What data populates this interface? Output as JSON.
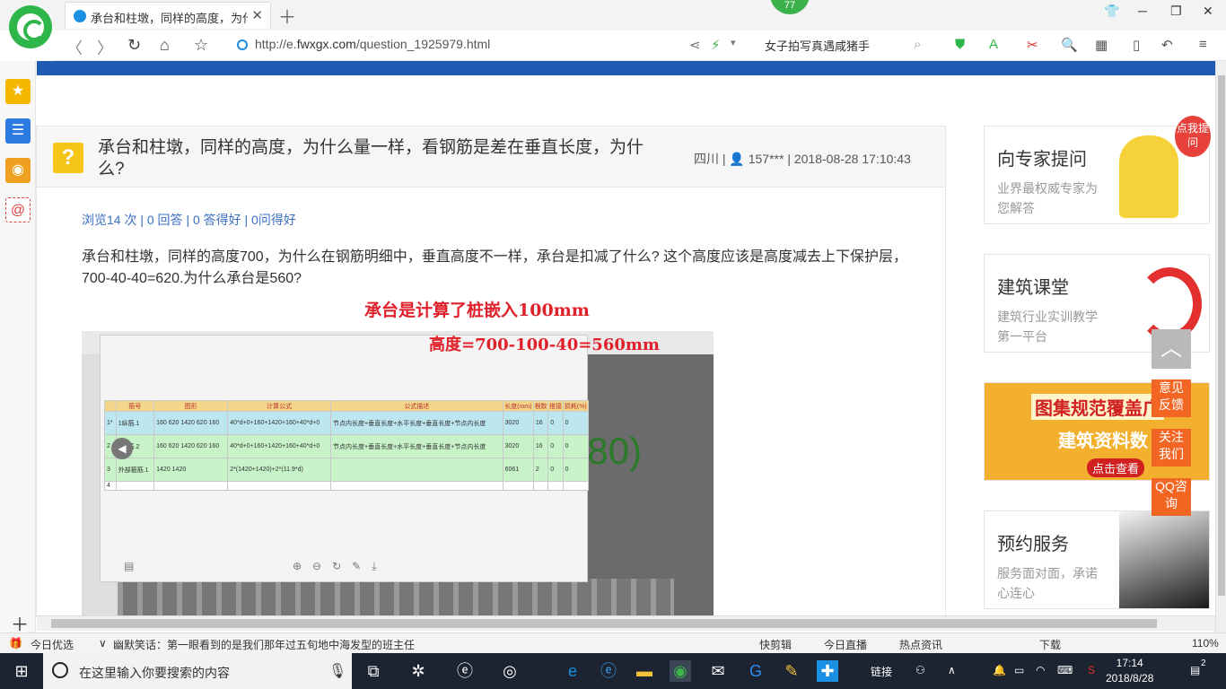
{
  "browser": {
    "tab_title": "承台和柱墩，同样的高度，为什么量...",
    "badge": "77",
    "url_prefix": "http://e.",
    "url_domain": "fwxgx.com",
    "url_path": "/question_1925979.html",
    "search_text": "女子拍写真遇咸猪手"
  },
  "question": {
    "title": "承台和柱墩，同样的高度，为什么量一样，看钢筋是差在垂直长度，为什么?",
    "meta": "四川 | 👤 157*** | 2018-08-28 17:10:43",
    "stats": "浏览14 次 | 0 回答 | 0 答得好 | 0问得好",
    "body": "承台和柱墩，同样的高度700，为什么在钢筋明细中，垂直高度不一样，承台是扣减了什么? 这个高度应该是高度减去上下保护层，700-40-40=620.为什么承台是560?",
    "annotation1": "承台是计算了桩嵌入100mm",
    "annotation2": "高度=700-100-40=560mm",
    "image_bg_text": "180)"
  },
  "rebar_table": {
    "headers": [
      "",
      "筋号",
      "图形",
      "计算公式",
      "公式描述",
      "长度(mm)",
      "根数",
      "搭接",
      "损耗(%)"
    ],
    "rows": [
      [
        "1*",
        "1纵筋.1",
        "160 620 1420 620 160",
        "40*d+0+160+1420+160+40*d+0",
        "节点内长度+垂直长度+水平长度+垂直长度+节点内长度",
        "3020",
        "16",
        "0",
        "0"
      ],
      [
        "2",
        "1纵筋.2",
        "160 620 1420 620 160",
        "40*d+0+160+1420+160+40*d+0",
        "节点内长度+垂直长度+水平长度+垂直长度+节点内长度",
        "3020",
        "16",
        "0",
        "0"
      ],
      [
        "3",
        "外部箍筋.1",
        "1420 1420",
        "2*(1420+1420)+2*(11.9*d)",
        "",
        "6061",
        "2",
        "0",
        "0"
      ],
      [
        "4",
        "",
        "",
        "",
        "",
        "",
        "",
        "",
        ""
      ]
    ]
  },
  "sidebar_ads": [
    {
      "title": "向专家提问",
      "sub": "业界最权威专家为您解答"
    },
    {
      "title": "建筑课堂",
      "sub": "建筑行业实训教学第一平台"
    },
    {
      "title": "图集规范覆盖广",
      "sub": "建筑资料数",
      "cta": "点击查看"
    },
    {
      "title": "预约服务",
      "sub": "服务面对面，承诺心连心"
    }
  ],
  "floats": {
    "feedback": "意见反馈",
    "follow": "关注我们",
    "qq": "QQ咨询",
    "bubble": "点我提问"
  },
  "statusbar": {
    "today": "今日优选",
    "news": "幽默笑话：第一眼看到的是我们那年过五旬地中海发型的班主任",
    "kuaijianji": "快剪辑",
    "live": "今日直播",
    "hot": "热点资讯",
    "download": "下载",
    "zoom": "110%"
  },
  "taskbar": {
    "search_placeholder": "在这里输入你要搜索的内容",
    "link": "链接",
    "time": "17:14",
    "date": "2018/8/28",
    "notify": "2"
  },
  "colors": {
    "brand_blue": "#1d5bb4",
    "accent_orange": "#f26522",
    "annotation_red": "#e0202a",
    "link_blue": "#3a6fc1"
  }
}
